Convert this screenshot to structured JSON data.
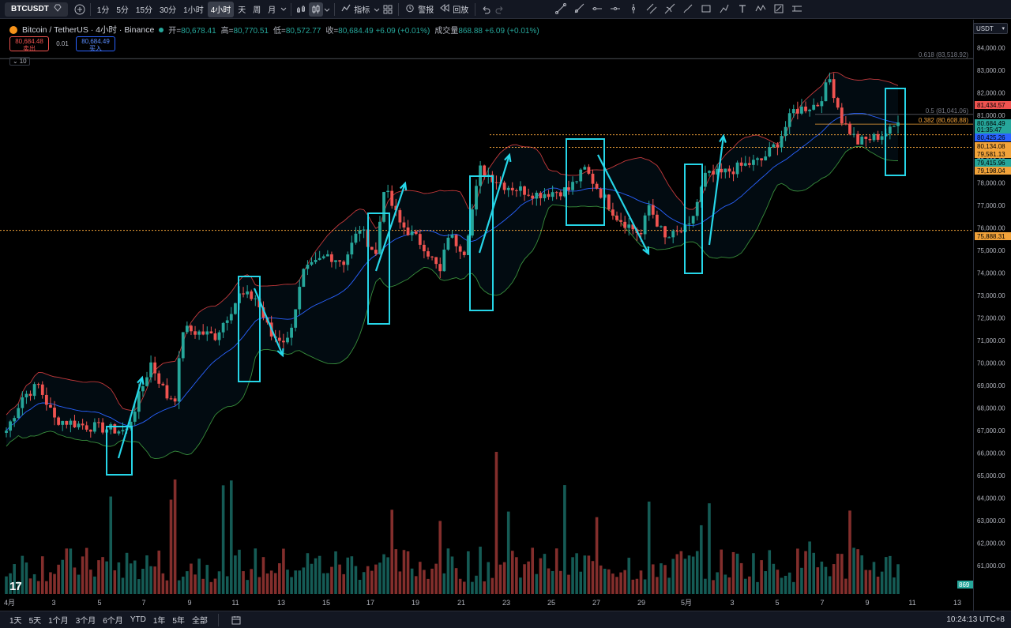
{
  "toolbar": {
    "symbol": "BTCUSDT",
    "intervals": [
      "1分",
      "5分",
      "15分",
      "30分",
      "1小时",
      "4小时",
      "天",
      "周",
      "月"
    ],
    "active_interval": "4小时",
    "indicators_label": "指标",
    "alert_label": "警报",
    "replay_label": "回放"
  },
  "legend": {
    "title": "Bitcoin / TetherUS · 4小时 · Binance",
    "open_label": "开=",
    "open": "80,678.41",
    "high_label": "高=",
    "high": "80,770.51",
    "low_label": "低=",
    "low": "80,572.77",
    "close_label": "收=",
    "close": "80,684.49 +6.09 (+0.01%)",
    "volume_label": "成交量",
    "volume": "868.88 +6.09 (+0.01%)"
  },
  "trade": {
    "sell_price": "80,684.48",
    "sell_label": "卖出",
    "spread": "0.01",
    "buy_price": "80,684.49",
    "buy_label": "买入",
    "indicator_badge": "10"
  },
  "currency": "USDT",
  "chart_data": {
    "type": "candlestick",
    "symbol": "BTCUSDT",
    "timeframe": "4小时",
    "y_ticks": [
      84000,
      83000,
      82000,
      81000,
      80000,
      79000,
      78000,
      77000,
      76000,
      75000,
      74000,
      73000,
      72000,
      71000,
      70000,
      69000,
      68000,
      67000,
      66000,
      65000,
      64000,
      63000,
      62000,
      61000
    ],
    "x_ticks": [
      "4月",
      "3",
      "5",
      "7",
      "9",
      "11",
      "13",
      "15",
      "17",
      "19",
      "21",
      "23",
      "25",
      "27",
      "29",
      "5月",
      "3",
      "5",
      "7",
      "9",
      "11",
      "13"
    ],
    "price_tags": [
      {
        "label": "81,434.57",
        "color": "#ef5350"
      },
      {
        "label": "80,684.49",
        "color": "#26a69a"
      },
      {
        "label": "01:35:47",
        "color": "#26a69a"
      },
      {
        "label": "80,425.26",
        "color": "#2962ff"
      },
      {
        "label": "80,134.08",
        "color": "#f2a33a"
      },
      {
        "label": "79,581.13",
        "color": "#f2a33a"
      },
      {
        "label": "79,415.96",
        "color": "#26a69a"
      },
      {
        "label": "79,198.04",
        "color": "#f2a33a"
      },
      {
        "label": "75,888.31",
        "color": "#f2a33a"
      },
      {
        "label": "869",
        "color": "#26a69a"
      }
    ],
    "fib_labels": [
      {
        "label": "0.618 (83,518.92)",
        "price": 83518.92
      },
      {
        "label": "0.5 (81,041.06)",
        "price": 81041.06
      },
      {
        "label": "0.382 (80,608.88)",
        "price": 80608.88
      }
    ],
    "dotted_levels": [
      80134.08,
      79581.13,
      75888.31
    ],
    "last_price": 80684.49,
    "last_volume": 869,
    "anchors": [
      [
        0,
        67000
      ],
      [
        4,
        68500
      ],
      [
        8,
        69000
      ],
      [
        12,
        67500
      ],
      [
        20,
        67200
      ],
      [
        28,
        67000
      ],
      [
        30,
        67000
      ],
      [
        36,
        70000
      ],
      [
        40,
        68500
      ],
      [
        42,
        68500
      ],
      [
        44,
        71500
      ],
      [
        52,
        71200
      ],
      [
        58,
        73000
      ],
      [
        62,
        72900
      ],
      [
        66,
        71200
      ],
      [
        70,
        71000
      ],
      [
        74,
        74000
      ],
      [
        80,
        74800
      ],
      [
        84,
        74500
      ],
      [
        88,
        76000
      ],
      [
        92,
        74800
      ],
      [
        94,
        77800
      ],
      [
        98,
        76200
      ],
      [
        104,
        75200
      ],
      [
        108,
        74000
      ],
      [
        110,
        75700
      ],
      [
        114,
        75000
      ],
      [
        118,
        78600
      ],
      [
        124,
        77900
      ],
      [
        132,
        77500
      ],
      [
        140,
        77700
      ],
      [
        144,
        78600
      ],
      [
        152,
        76500
      ],
      [
        158,
        75700
      ],
      [
        160,
        77000
      ],
      [
        164,
        75500
      ],
      [
        170,
        76000
      ],
      [
        174,
        78300
      ],
      [
        178,
        78400
      ],
      [
        184,
        78800
      ],
      [
        188,
        79000
      ],
      [
        192,
        79800
      ],
      [
        196,
        81200
      ],
      [
        202,
        81500
      ],
      [
        205,
        82600
      ],
      [
        208,
        80800
      ],
      [
        212,
        79800
      ],
      [
        216,
        80000
      ],
      [
        220,
        80300
      ],
      [
        222,
        80684
      ]
    ]
  }
}
